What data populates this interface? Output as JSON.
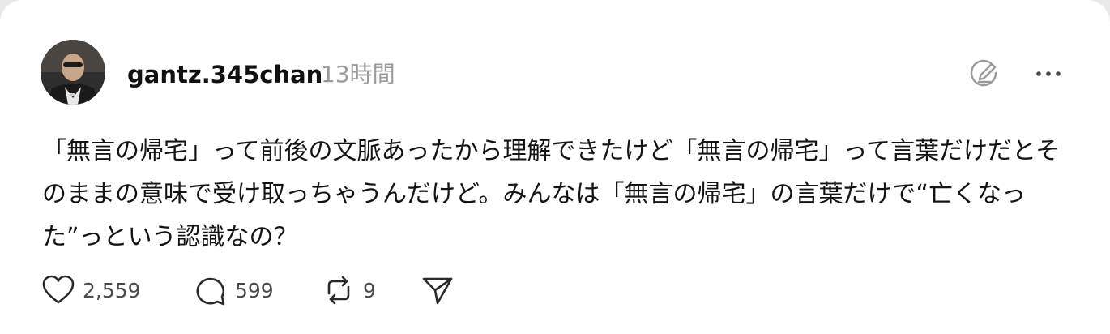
{
  "post": {
    "author": {
      "username": "gantz.345chan",
      "timestamp": "13時間"
    },
    "text": "「無言の帰宅」って前後の文脈あったから理解できたけど「無言の帰宅」って言葉だけだとそのままの意味で受け取っちゃうんだけど。みんなは「無言の帰宅」の言葉だけで“亡くなった”っという認識なの？",
    "actions": {
      "likes": "2,559",
      "replies": "599",
      "reposts": "9"
    }
  },
  "icons": {
    "edit": "edit-circle-icon",
    "more": "more-horizontal-icon",
    "like": "heart-icon",
    "reply": "comment-bubble-icon",
    "repost": "repost-arrows-icon",
    "share": "send-paper-plane-icon"
  },
  "colors": {
    "text": "#141414",
    "muted": "#9a9a9a",
    "icon": "#4a4a4a",
    "background": "#ffffff"
  }
}
